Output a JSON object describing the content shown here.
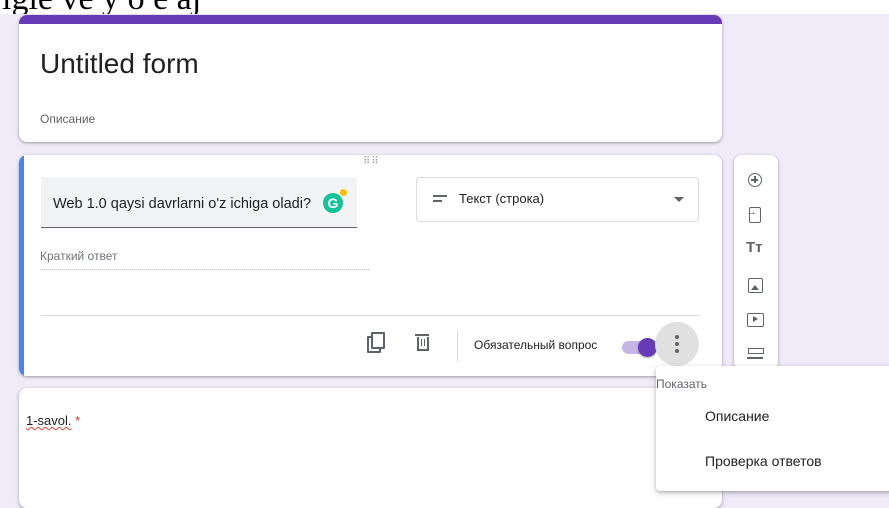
{
  "overlay_text": "igle ve y o  e aj",
  "form": {
    "title": "Untitled form",
    "description_placeholder": "Описание"
  },
  "question": {
    "text": "Web 1.0 qaysi davrlarni o'z ichiga oladi?",
    "grammarly_badge": "G",
    "type_label": "Текст (строка)",
    "answer_placeholder": "Краткий ответ",
    "required_label": "Обязательный вопрос",
    "required": true
  },
  "toolbar": {
    "icons": [
      "add-question-icon",
      "import-questions-icon",
      "title-text-icon",
      "image-icon",
      "video-icon",
      "section-icon"
    ],
    "title_text_glyph": "Tт"
  },
  "question2": {
    "label": "1-savol.",
    "required_star": "*"
  },
  "menu": {
    "header": "Показать",
    "items": [
      "Описание",
      "Проверка ответов"
    ]
  },
  "colors": {
    "accent": "#673ab7",
    "active_card_accent": "#4285f4",
    "background": "#f0ebf8"
  }
}
